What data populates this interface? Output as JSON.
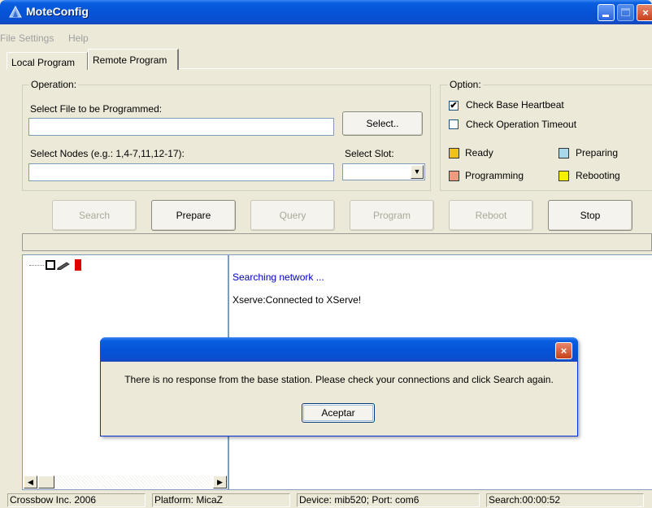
{
  "window": {
    "title": "MoteConfig",
    "close_glyph": "×"
  },
  "menu": [
    "File",
    "Settings",
    "Help"
  ],
  "tabs": {
    "local": "Local Program",
    "remote": "Remote Program",
    "active": "Remote Program"
  },
  "operation": {
    "group_title": "Operation:",
    "file_label": "Select File to be Programmed:",
    "file_value": "",
    "select_button": "Select..",
    "nodes_label": "Select Nodes (e.g.: 1,4-7,11,12-17):",
    "nodes_value": "",
    "slot_label": "Select Slot:",
    "slot_value": "",
    "combo_arrow": "▼"
  },
  "option": {
    "group_title": "Option:",
    "check_base_heartbeat": {
      "label": "Check Base Heartbeat",
      "checked": true,
      "mark": "✔"
    },
    "check_operation_timeout": {
      "label": "Check Operation Timeout",
      "checked": false,
      "mark": ""
    }
  },
  "legend": [
    {
      "label": "Ready",
      "color": "#f0c020"
    },
    {
      "label": "Preparing",
      "color": "#a8d8ea"
    },
    {
      "label": "Programming",
      "color": "#f09a80"
    },
    {
      "label": "Rebooting",
      "color": "#f5f000"
    }
  ],
  "buttons": {
    "search": {
      "label": "Search",
      "enabled": false
    },
    "prepare": {
      "label": "Prepare",
      "enabled": true
    },
    "query": {
      "label": "Query",
      "enabled": false
    },
    "program": {
      "label": "Program",
      "enabled": false
    },
    "reboot": {
      "label": "Reboot",
      "enabled": false
    },
    "stop": {
      "label": "Stop",
      "enabled": true
    }
  },
  "tree": {
    "scroll_left": "◀",
    "scroll_right": "▶"
  },
  "log": {
    "lines": [
      {
        "text": "Searching network ...",
        "color": "#0000c0"
      },
      {
        "text": "Xserve:Connected to XServe!",
        "color": "#000000"
      }
    ]
  },
  "dialog": {
    "message": "There is no response from the base station. Please check your connections and click Search again.",
    "ok_label": "Aceptar",
    "close_glyph": "×"
  },
  "statusbar": {
    "company": "Crossbow Inc. 2006",
    "platform": "Platform: MicaZ",
    "device": "Device: mib520; Port: com6",
    "search": "Search:00:00:52"
  }
}
